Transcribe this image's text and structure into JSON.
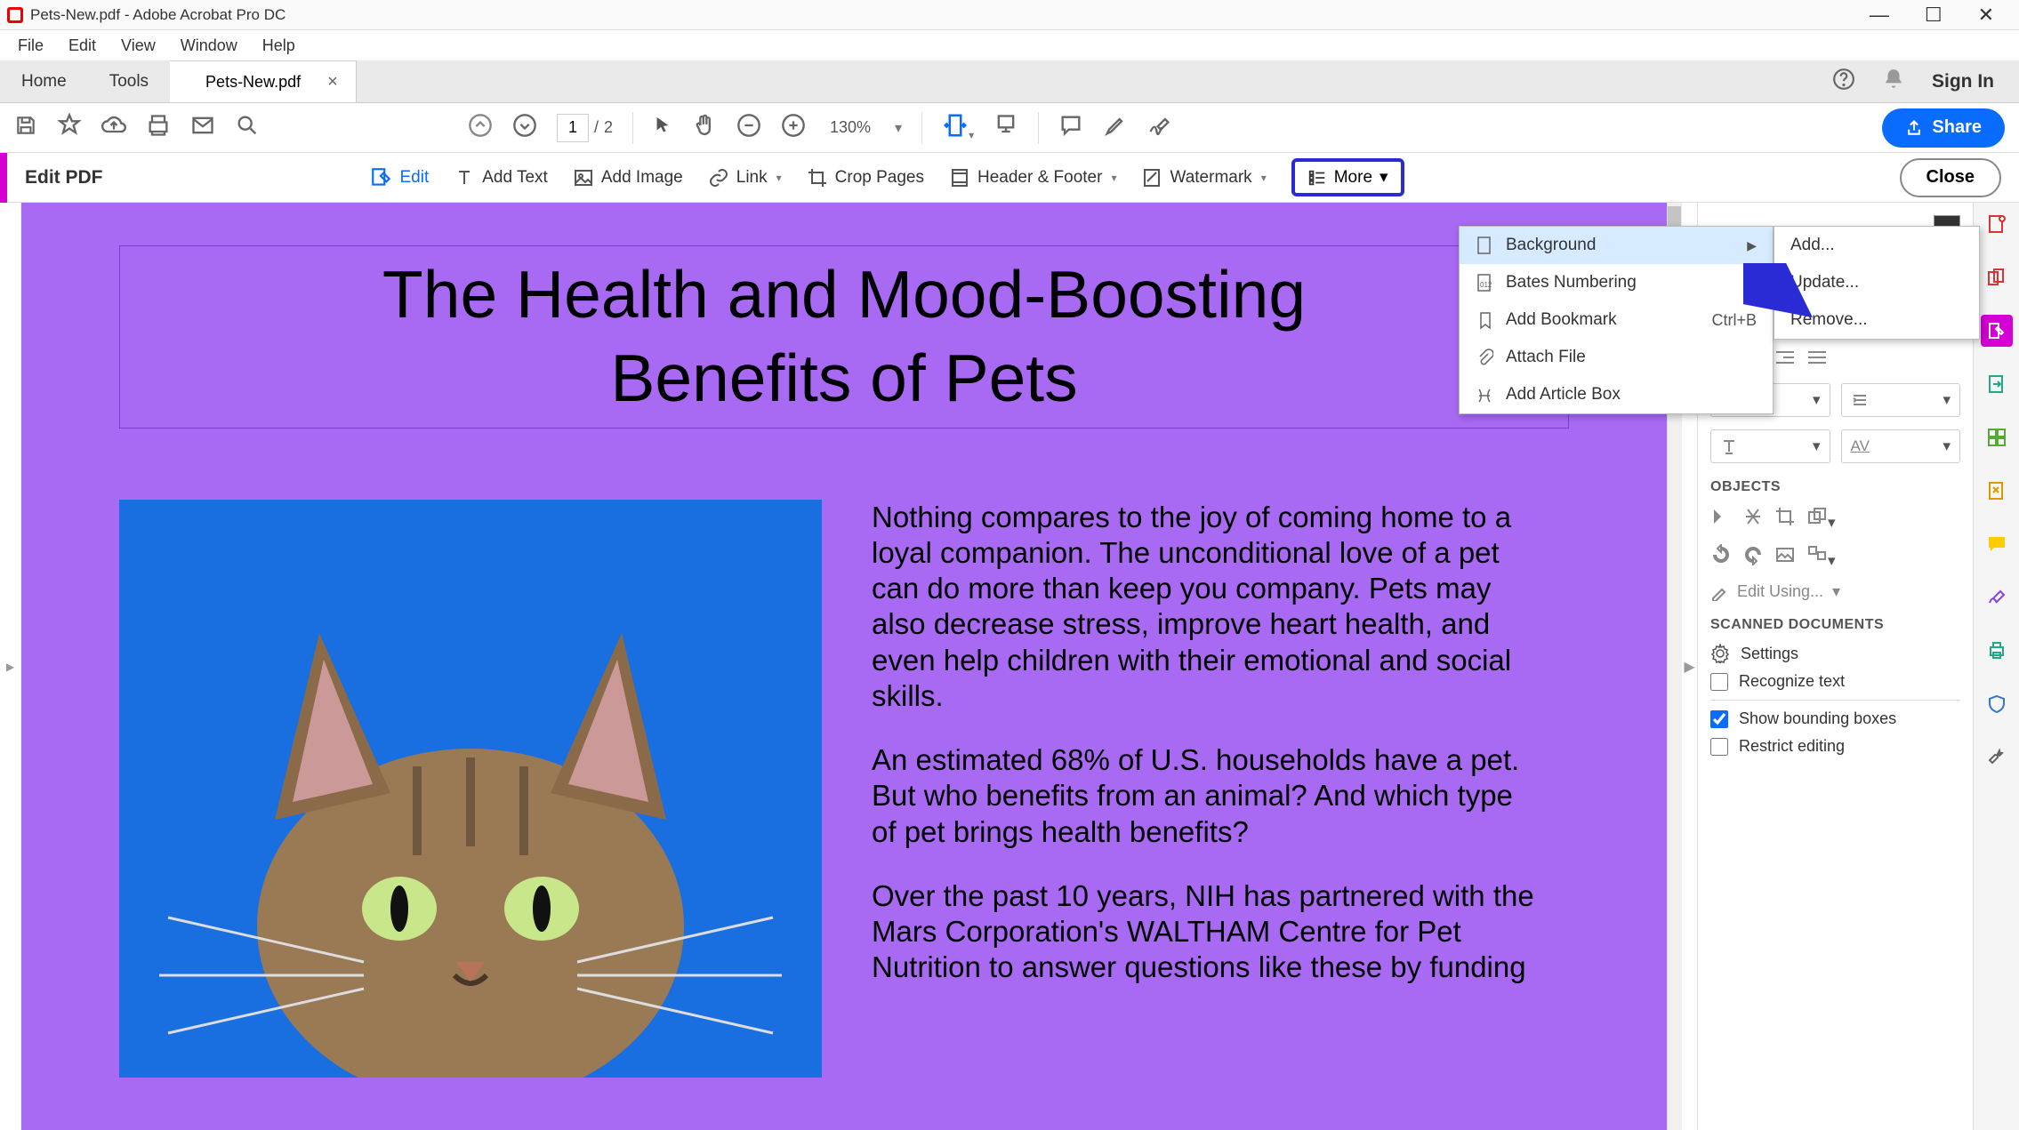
{
  "window": {
    "title": "Pets-New.pdf - Adobe Acrobat Pro DC"
  },
  "menu": {
    "file": "File",
    "edit": "Edit",
    "view": "View",
    "window": "Window",
    "help": "Help"
  },
  "tabs": {
    "home": "Home",
    "tools": "Tools",
    "doc": "Pets-New.pdf"
  },
  "header_right": {
    "signin": "Sign In"
  },
  "toolbar": {
    "page_current": "1",
    "page_sep": "/",
    "page_total": "2",
    "zoom": "130%",
    "share": "Share"
  },
  "editbar": {
    "label": "Edit PDF",
    "edit": "Edit",
    "add_text": "Add Text",
    "add_image": "Add Image",
    "link": "Link",
    "crop": "Crop Pages",
    "header_footer": "Header & Footer",
    "watermark": "Watermark",
    "more": "More",
    "close": "Close"
  },
  "more_menu": {
    "background": "Background",
    "bates": "Bates Numbering",
    "bookmark": "Add Bookmark",
    "bookmark_shortcut": "Ctrl+B",
    "attach": "Attach File",
    "article": "Add Article Box"
  },
  "bg_submenu": {
    "add": "Add...",
    "update": "Update...",
    "remove": "Remove..."
  },
  "doc": {
    "title_l1": "The Health and Mood-Boosting",
    "title_l2": "Benefits of Pets",
    "p1": "Nothing compares to the joy of coming home to a loyal companion. The unconditional love of a pet can do more than keep you company. Pets may also decrease stress, improve heart health,  and  even  help children  with  their emotional and social skills.",
    "p2": "An estimated 68% of U.S. households have a pet. But who benefits from an animal? And which type of pet brings health benefits?",
    "p3": "Over  the  past  10  years,  NIH  has partnered with the Mars Corporation's WALTHAM Centre for  Pet  Nutrition  to answer  questions  like these by funding"
  },
  "right_panel": {
    "objects": "OBJECTS",
    "edit_using": "Edit Using...",
    "scanned": "SCANNED DOCUMENTS",
    "settings": "Settings",
    "recognize": "Recognize text",
    "show_boxes": "Show bounding boxes",
    "restrict": "Restrict editing"
  }
}
